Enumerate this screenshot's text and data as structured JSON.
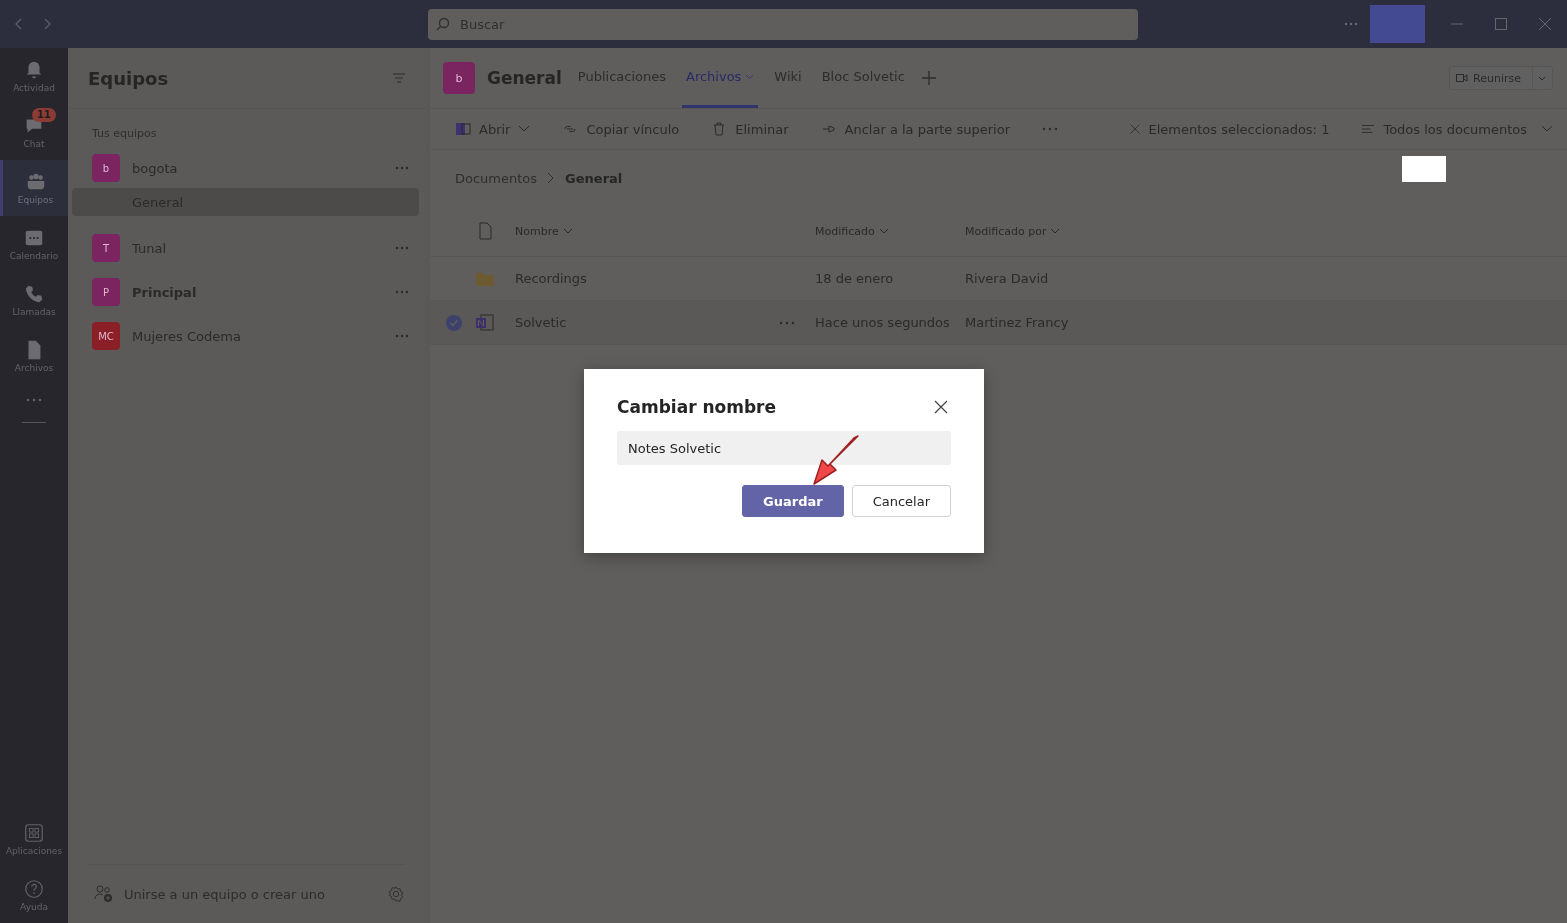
{
  "title_bar": {
    "search": {
      "placeholder": "Buscar"
    }
  },
  "app_bar": {
    "items": [
      {
        "label": "Actividad",
        "selected": false
      },
      {
        "label": "Chat",
        "selected": false,
        "badge": "11"
      },
      {
        "label": "Equipos",
        "selected": true
      },
      {
        "label": "Calendario",
        "selected": false
      },
      {
        "label": "Llamadas",
        "selected": false
      },
      {
        "label": "Archivos",
        "selected": false
      }
    ],
    "bottom_items": [
      {
        "label": "Aplicaciones"
      },
      {
        "label": "Ayuda"
      }
    ]
  },
  "teams_panel": {
    "title": "Equipos",
    "section": "Tus equipos",
    "teams": [
      {
        "initials": "b",
        "name": "bogota",
        "color": "#7a2560",
        "unread": false,
        "channels": [
          {
            "name": "General",
            "selected": true
          }
        ]
      },
      {
        "initials": "T",
        "name": "Tunal",
        "color": "#7a2560",
        "unread": false
      },
      {
        "initials": "P",
        "name": "Principal",
        "color": "#7a2560",
        "unread": true
      },
      {
        "initials": "MC",
        "name": "Mujeres Codema",
        "color": "#8a1f28",
        "unread": false
      }
    ],
    "footer": "Unirse a un equipo o crear uno"
  },
  "channel_header": {
    "initials": "b",
    "title": "General",
    "tabs": [
      {
        "label": "Publicaciones",
        "selected": false
      },
      {
        "label": "Archivos",
        "selected": true
      },
      {
        "label": "Wiki",
        "selected": false
      },
      {
        "label": "Bloc Solvetic",
        "selected": false
      }
    ],
    "meet_button": "Reunirse"
  },
  "toolbar": {
    "actions": [
      "Abrir",
      "Copiar vínculo",
      "Eliminar",
      "Anclar a la parte superior"
    ],
    "selection": "Elementos seleccionados: 1",
    "view": "Todos los documentos"
  },
  "breadcrumb": [
    "Documentos",
    "General"
  ],
  "table": {
    "columns": [
      "Nombre",
      "Modificado",
      "Modificado por"
    ],
    "rows": [
      {
        "kind": "folder",
        "name": "Recordings",
        "modified": "18 de enero",
        "modified_by": "Rivera David",
        "selected": false
      },
      {
        "kind": "notebook",
        "name": "Solvetic",
        "modified": "Hace unos segundos",
        "modified_by": "Martinez Francy",
        "selected": true
      }
    ]
  },
  "dialog": {
    "title": "Cambiar nombre",
    "value": "Notes Solvetic",
    "buttons": [
      {
        "label": "Guardar",
        "kind": "primary"
      },
      {
        "label": "Cancelar",
        "kind": "secondary"
      }
    ]
  }
}
